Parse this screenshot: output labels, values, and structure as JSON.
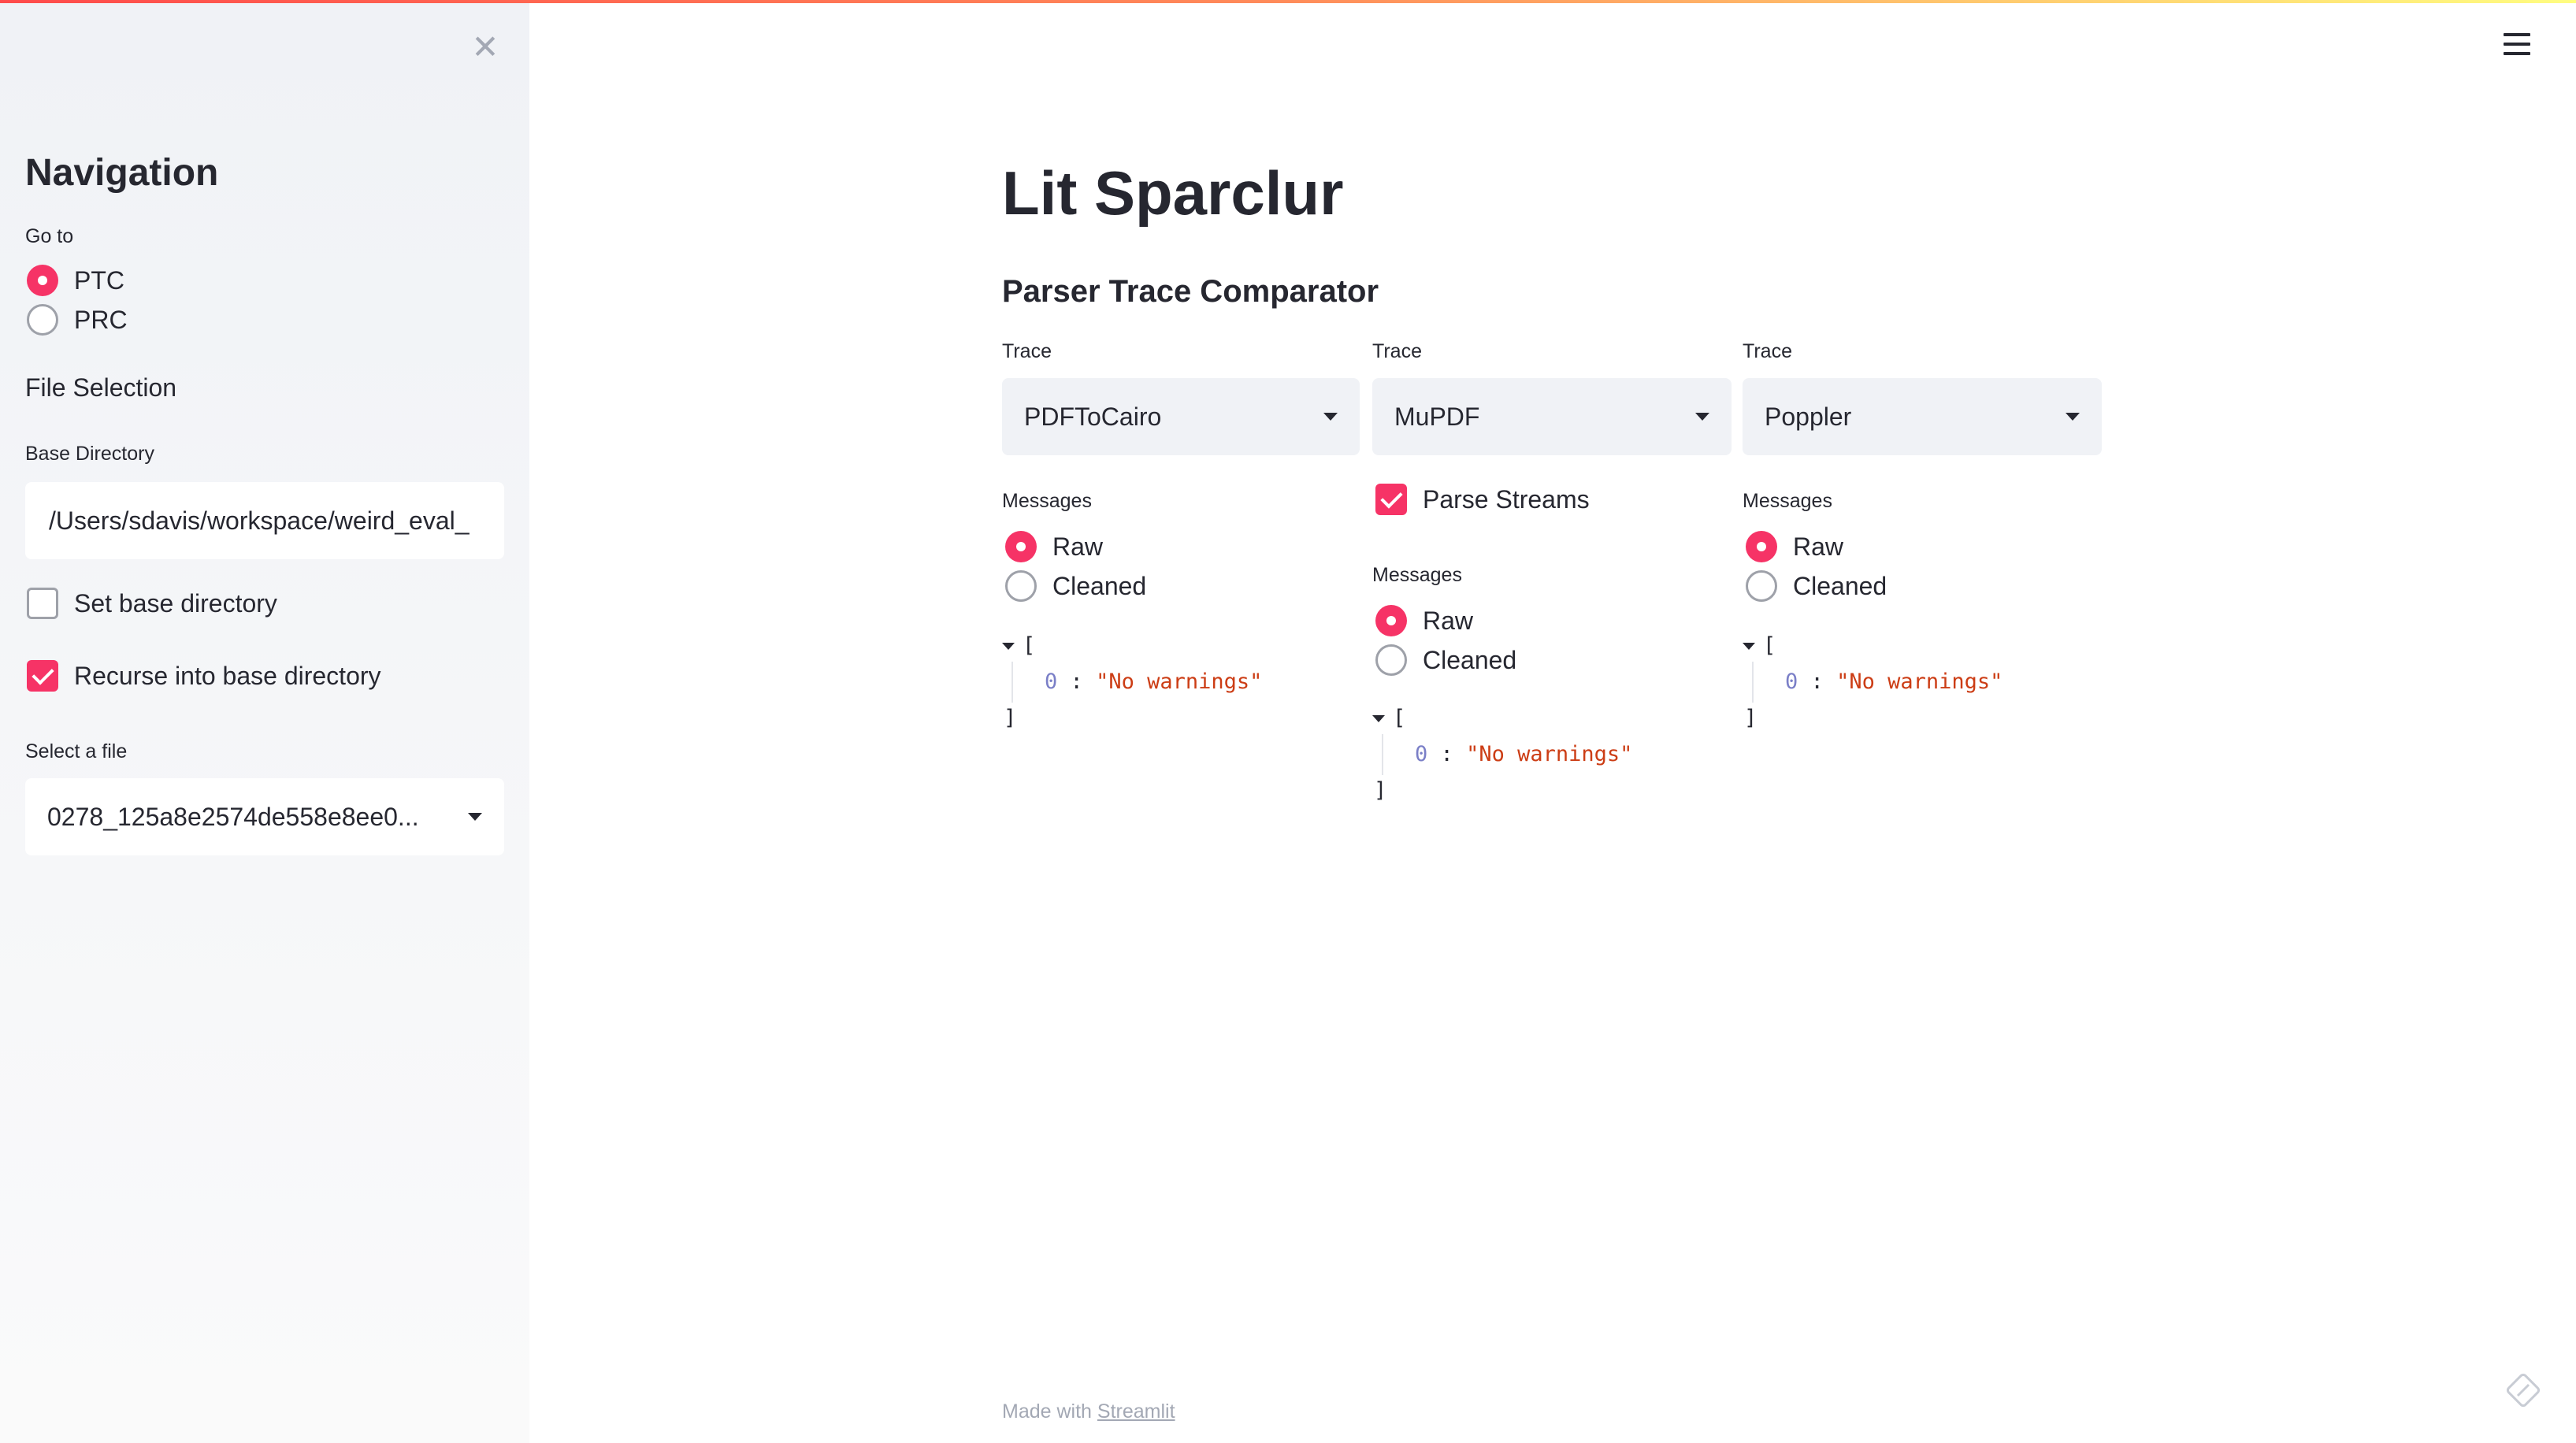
{
  "sidebar": {
    "title": "Navigation",
    "goto_label": "Go to",
    "goto_options": [
      {
        "label": "PTC",
        "selected": true
      },
      {
        "label": "PRC",
        "selected": false
      }
    ],
    "file_selection_label": "File Selection",
    "base_directory_label": "Base Directory",
    "base_directory_value": "/Users/sdavis/workspace/weird_eval_",
    "set_base_directory": {
      "label": "Set base directory",
      "checked": false
    },
    "recurse": {
      "label": "Recurse into base directory",
      "checked": true
    },
    "select_file_label": "Select a file",
    "select_file_value": "0278_125a8e2574de558e8ee0..."
  },
  "main": {
    "title": "Lit Sparclur",
    "subtitle": "Parser Trace Comparator",
    "columns": [
      {
        "trace_label": "Trace",
        "trace_value": "PDFToCairo",
        "messages_label": "Messages",
        "options": [
          {
            "label": "Raw",
            "selected": true
          },
          {
            "label": "Cleaned",
            "selected": false
          }
        ],
        "json": {
          "open": "[",
          "index": "0",
          "sep": ":",
          "value": "\"No warnings\"",
          "close": "]"
        }
      },
      {
        "trace_label": "Trace",
        "trace_value": "MuPDF",
        "parse_streams": {
          "label": "Parse Streams",
          "checked": true
        },
        "messages_label": "Messages",
        "options": [
          {
            "label": "Raw",
            "selected": true
          },
          {
            "label": "Cleaned",
            "selected": false
          }
        ],
        "json": {
          "open": "[",
          "index": "0",
          "sep": ":",
          "value": "\"No warnings\"",
          "close": "]"
        }
      },
      {
        "trace_label": "Trace",
        "trace_value": "Poppler",
        "messages_label": "Messages",
        "options": [
          {
            "label": "Raw",
            "selected": true
          },
          {
            "label": "Cleaned",
            "selected": false
          }
        ],
        "json": {
          "open": "[",
          "index": "0",
          "sep": ":",
          "value": "\"No warnings\"",
          "close": "]"
        }
      }
    ]
  },
  "footer": {
    "made_with": "Made with",
    "link": "Streamlit"
  },
  "colors": {
    "accent": "#f63366",
    "sidebar_bg": "#f0f2f6",
    "select_bg": "#f0f2f6"
  }
}
